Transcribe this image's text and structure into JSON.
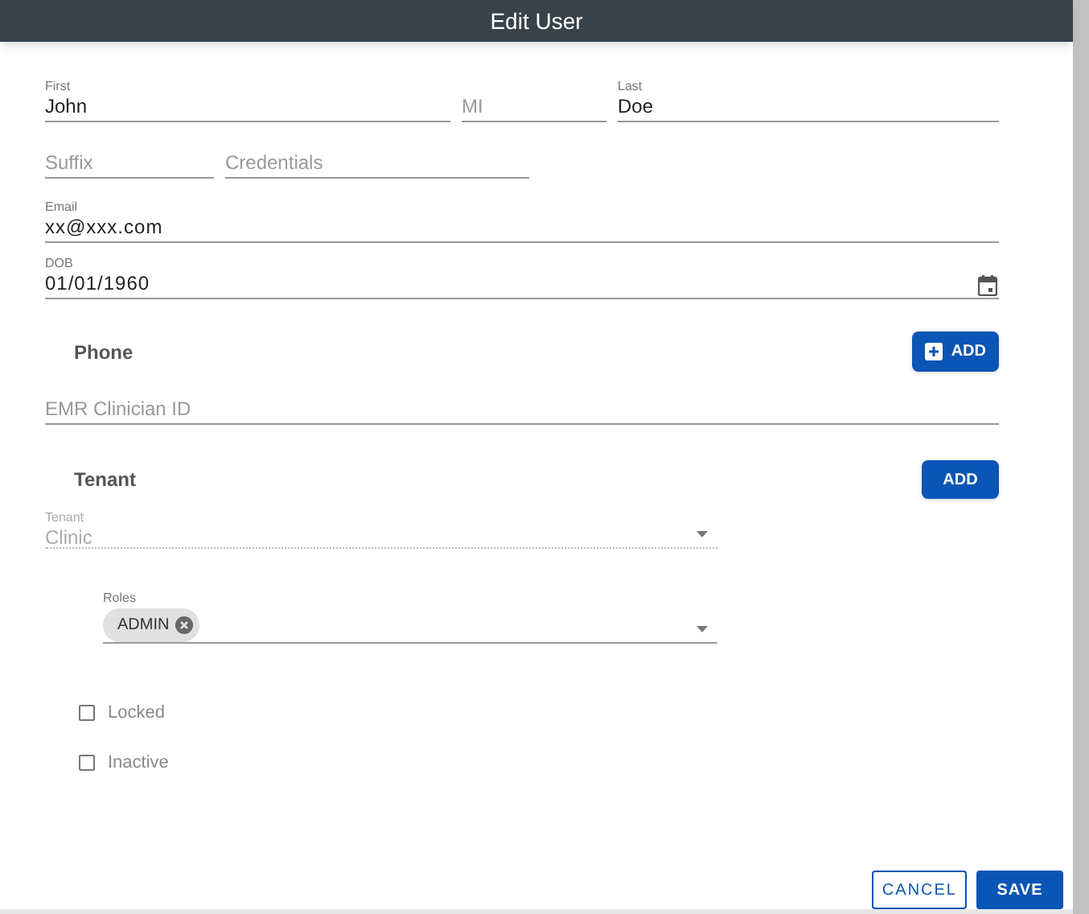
{
  "title": "Edit User",
  "name_fields": [
    {
      "label": "First",
      "value": "John"
    },
    {
      "placeholder": "MI"
    },
    {
      "label": "Last",
      "value": "Doe"
    }
  ],
  "suffix_fields": [
    {
      "placeholder": "Suffix"
    },
    {
      "placeholder": "Credentials"
    }
  ],
  "email": {
    "label": "Email",
    "value": "xx@xxx.com"
  },
  "dob": {
    "label": "DOB",
    "value": "01/01/1960"
  },
  "phone": {
    "heading": "Phone",
    "button": "ADD"
  },
  "emr": {
    "placeholder": "EMR Clinician ID"
  },
  "tenant_section": {
    "heading": "Tenant",
    "button": "ADD"
  },
  "tenant_select": {
    "label": "Tenant",
    "value": "Clinic",
    "disabled": true
  },
  "roles": {
    "label": "Roles",
    "chips": [
      "ADMIN"
    ]
  },
  "checkboxes": [
    {
      "label": "Locked",
      "checked": false
    },
    {
      "label": "Inactive",
      "checked": false
    }
  ],
  "actions": [
    {
      "label": "CANCEL",
      "kind": "outlined"
    },
    {
      "label": "SAVE",
      "kind": "filled"
    }
  ]
}
